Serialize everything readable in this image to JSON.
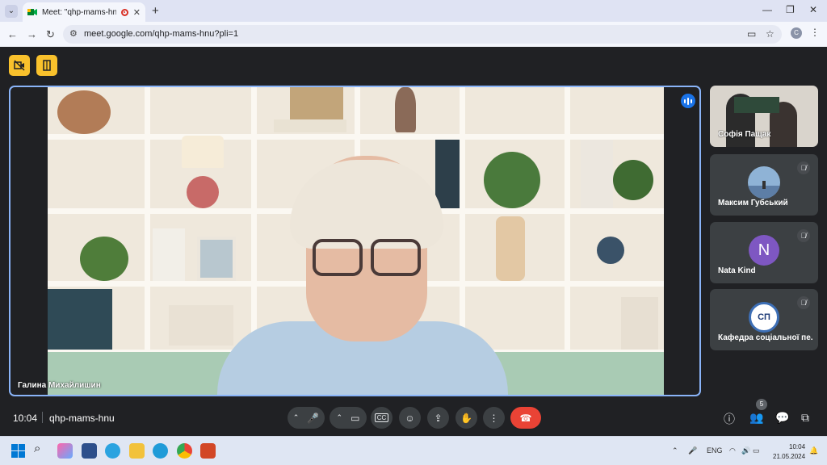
{
  "browser": {
    "tab_title": "Meet: \"qhp-mams-hnu\"",
    "url": "meet.google.com/qhp-mams-hnu?pli=1",
    "profile_initial": "C"
  },
  "main_speaker": {
    "name": "Галина Михайлишин"
  },
  "participants": [
    {
      "name": "Софія Пащак",
      "muted": false
    },
    {
      "name": "Максим Губський",
      "muted": true
    },
    {
      "name": "Nata Kind",
      "muted": true,
      "initial": "N"
    },
    {
      "name": "Кафедра соціальної пе...",
      "muted": true,
      "logo_text": "СП"
    }
  ],
  "bottom_bar": {
    "time": "10:04",
    "meeting_code": "qhp-mams-hnu",
    "people_count": "5"
  },
  "taskbar": {
    "language": "ENG",
    "time": "10:04",
    "date": "21.05.2024"
  },
  "colors": {
    "accent": "#8ab4f8",
    "end_call": "#ea4335",
    "yellow": "#f9c12c",
    "avatar_purple": "#7e57c2"
  }
}
